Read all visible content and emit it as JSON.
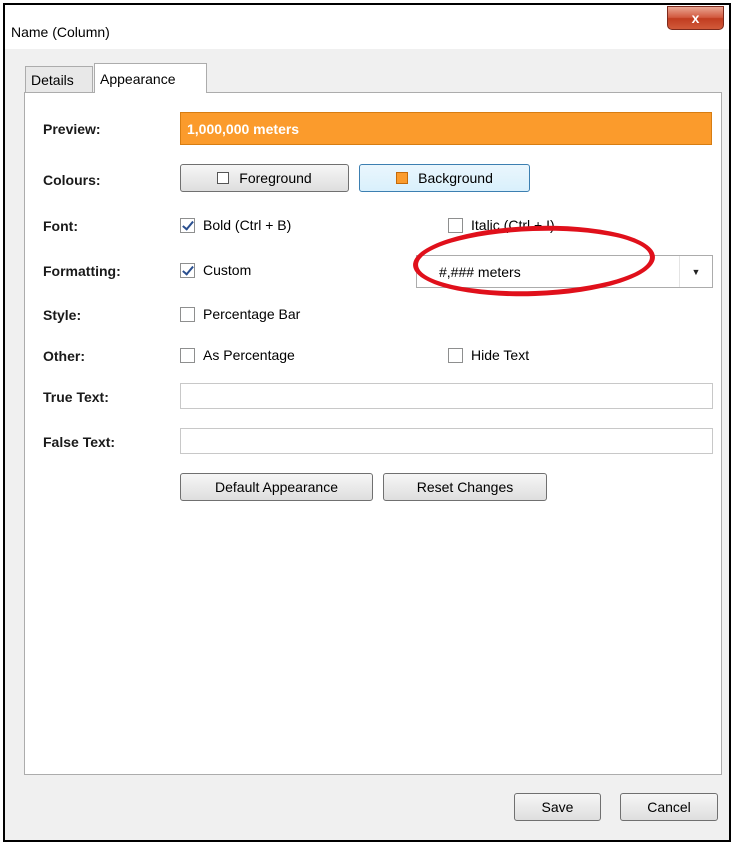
{
  "window": {
    "title": "Name (Column)",
    "close_glyph": "x"
  },
  "tabs": [
    {
      "label": "Details",
      "active": false
    },
    {
      "label": "Appearance",
      "active": true
    }
  ],
  "appearance": {
    "preview": {
      "label": "Preview:",
      "text": "1,000,000 meters",
      "background_color": "#fb9b2c",
      "text_color": "#ffffff"
    },
    "colours": {
      "label": "Colours:",
      "foreground_button": "Foreground",
      "background_button": "Background"
    },
    "font": {
      "label": "Font:",
      "bold": {
        "label": "Bold (Ctrl + B)",
        "checked": true
      },
      "italic": {
        "label": "Italic (Ctrl + I)",
        "checked": false
      }
    },
    "formatting": {
      "label": "Formatting:",
      "custom": {
        "label": "Custom",
        "checked": true
      },
      "format_value": "#,### meters"
    },
    "style": {
      "label": "Style:",
      "percentage_bar": {
        "label": "Percentage Bar",
        "checked": false
      }
    },
    "other": {
      "label": "Other:",
      "as_percentage": {
        "label": "As Percentage",
        "checked": false
      },
      "hide_text": {
        "label": "Hide Text",
        "checked": false
      }
    },
    "true_text": {
      "label": "True Text:",
      "value": ""
    },
    "false_text": {
      "label": "False Text:",
      "value": ""
    },
    "default_appearance_button": "Default Appearance",
    "reset_changes_button": "Reset Changes"
  },
  "footer": {
    "save_button": "Save",
    "cancel_button": "Cancel"
  },
  "annotation": {
    "color": "#e0101b",
    "shape": "ellipse"
  }
}
